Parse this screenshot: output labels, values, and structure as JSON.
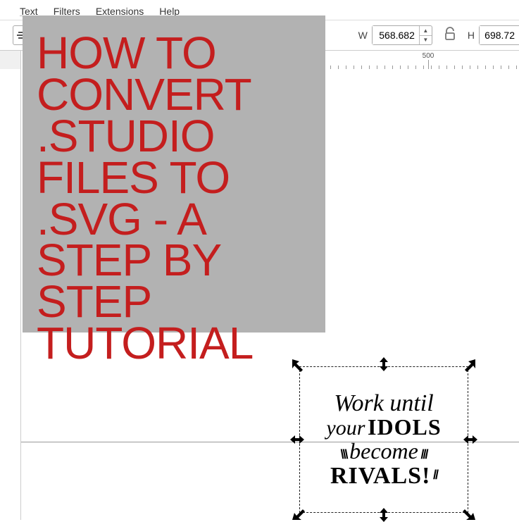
{
  "menu": {
    "text": "Text",
    "filters": "Filters",
    "extensions": "Extensions",
    "help": "Help"
  },
  "toolbar": {
    "w_label": "W",
    "w_value": "568.682",
    "h_label": "H",
    "h_value": "698.72"
  },
  "ruler": {
    "major1": "500",
    "major2": "500"
  },
  "artwork": {
    "line1": "Work until",
    "line2a": "your",
    "line2b": "IDOLS",
    "line3": "become",
    "line4": "RIVALS!"
  },
  "overlay": {
    "text": "HOW TO CONVERT .STUDIO FILES TO  .SVG - A STEP BY STEP TUTORIAL"
  }
}
